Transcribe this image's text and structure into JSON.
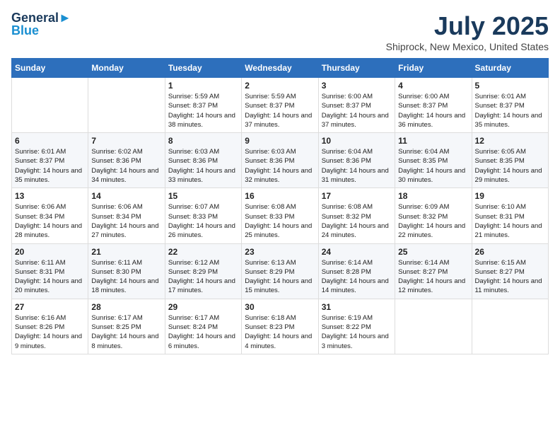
{
  "header": {
    "logo_line1": "General",
    "logo_line2": "Blue",
    "month_title": "July 2025",
    "location": "Shiprock, New Mexico, United States"
  },
  "weekdays": [
    "Sunday",
    "Monday",
    "Tuesday",
    "Wednesday",
    "Thursday",
    "Friday",
    "Saturday"
  ],
  "weeks": [
    [
      {
        "day": "",
        "content": ""
      },
      {
        "day": "",
        "content": ""
      },
      {
        "day": "1",
        "content": "Sunrise: 5:59 AM\nSunset: 8:37 PM\nDaylight: 14 hours and 38 minutes."
      },
      {
        "day": "2",
        "content": "Sunrise: 5:59 AM\nSunset: 8:37 PM\nDaylight: 14 hours and 37 minutes."
      },
      {
        "day": "3",
        "content": "Sunrise: 6:00 AM\nSunset: 8:37 PM\nDaylight: 14 hours and 37 minutes."
      },
      {
        "day": "4",
        "content": "Sunrise: 6:00 AM\nSunset: 8:37 PM\nDaylight: 14 hours and 36 minutes."
      },
      {
        "day": "5",
        "content": "Sunrise: 6:01 AM\nSunset: 8:37 PM\nDaylight: 14 hours and 35 minutes."
      }
    ],
    [
      {
        "day": "6",
        "content": "Sunrise: 6:01 AM\nSunset: 8:37 PM\nDaylight: 14 hours and 35 minutes."
      },
      {
        "day": "7",
        "content": "Sunrise: 6:02 AM\nSunset: 8:36 PM\nDaylight: 14 hours and 34 minutes."
      },
      {
        "day": "8",
        "content": "Sunrise: 6:03 AM\nSunset: 8:36 PM\nDaylight: 14 hours and 33 minutes."
      },
      {
        "day": "9",
        "content": "Sunrise: 6:03 AM\nSunset: 8:36 PM\nDaylight: 14 hours and 32 minutes."
      },
      {
        "day": "10",
        "content": "Sunrise: 6:04 AM\nSunset: 8:36 PM\nDaylight: 14 hours and 31 minutes."
      },
      {
        "day": "11",
        "content": "Sunrise: 6:04 AM\nSunset: 8:35 PM\nDaylight: 14 hours and 30 minutes."
      },
      {
        "day": "12",
        "content": "Sunrise: 6:05 AM\nSunset: 8:35 PM\nDaylight: 14 hours and 29 minutes."
      }
    ],
    [
      {
        "day": "13",
        "content": "Sunrise: 6:06 AM\nSunset: 8:34 PM\nDaylight: 14 hours and 28 minutes."
      },
      {
        "day": "14",
        "content": "Sunrise: 6:06 AM\nSunset: 8:34 PM\nDaylight: 14 hours and 27 minutes."
      },
      {
        "day": "15",
        "content": "Sunrise: 6:07 AM\nSunset: 8:33 PM\nDaylight: 14 hours and 26 minutes."
      },
      {
        "day": "16",
        "content": "Sunrise: 6:08 AM\nSunset: 8:33 PM\nDaylight: 14 hours and 25 minutes."
      },
      {
        "day": "17",
        "content": "Sunrise: 6:08 AM\nSunset: 8:32 PM\nDaylight: 14 hours and 24 minutes."
      },
      {
        "day": "18",
        "content": "Sunrise: 6:09 AM\nSunset: 8:32 PM\nDaylight: 14 hours and 22 minutes."
      },
      {
        "day": "19",
        "content": "Sunrise: 6:10 AM\nSunset: 8:31 PM\nDaylight: 14 hours and 21 minutes."
      }
    ],
    [
      {
        "day": "20",
        "content": "Sunrise: 6:11 AM\nSunset: 8:31 PM\nDaylight: 14 hours and 20 minutes."
      },
      {
        "day": "21",
        "content": "Sunrise: 6:11 AM\nSunset: 8:30 PM\nDaylight: 14 hours and 18 minutes."
      },
      {
        "day": "22",
        "content": "Sunrise: 6:12 AM\nSunset: 8:29 PM\nDaylight: 14 hours and 17 minutes."
      },
      {
        "day": "23",
        "content": "Sunrise: 6:13 AM\nSunset: 8:29 PM\nDaylight: 14 hours and 15 minutes."
      },
      {
        "day": "24",
        "content": "Sunrise: 6:14 AM\nSunset: 8:28 PM\nDaylight: 14 hours and 14 minutes."
      },
      {
        "day": "25",
        "content": "Sunrise: 6:14 AM\nSunset: 8:27 PM\nDaylight: 14 hours and 12 minutes."
      },
      {
        "day": "26",
        "content": "Sunrise: 6:15 AM\nSunset: 8:27 PM\nDaylight: 14 hours and 11 minutes."
      }
    ],
    [
      {
        "day": "27",
        "content": "Sunrise: 6:16 AM\nSunset: 8:26 PM\nDaylight: 14 hours and 9 minutes."
      },
      {
        "day": "28",
        "content": "Sunrise: 6:17 AM\nSunset: 8:25 PM\nDaylight: 14 hours and 8 minutes."
      },
      {
        "day": "29",
        "content": "Sunrise: 6:17 AM\nSunset: 8:24 PM\nDaylight: 14 hours and 6 minutes."
      },
      {
        "day": "30",
        "content": "Sunrise: 6:18 AM\nSunset: 8:23 PM\nDaylight: 14 hours and 4 minutes."
      },
      {
        "day": "31",
        "content": "Sunrise: 6:19 AM\nSunset: 8:22 PM\nDaylight: 14 hours and 3 minutes."
      },
      {
        "day": "",
        "content": ""
      },
      {
        "day": "",
        "content": ""
      }
    ]
  ]
}
